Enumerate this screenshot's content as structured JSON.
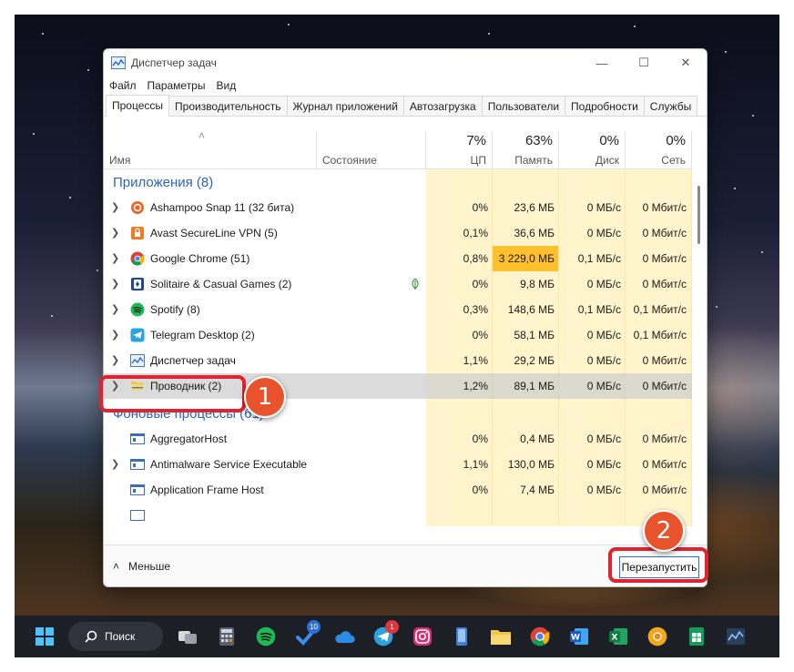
{
  "window": {
    "title": "Диспетчер задач",
    "menu": [
      "Файл",
      "Параметры",
      "Вид"
    ],
    "tabs": [
      "Процессы",
      "Производительность",
      "Журнал приложений",
      "Автозагрузка",
      "Пользователи",
      "Подробности",
      "Службы"
    ],
    "active_tab": "Процессы"
  },
  "columns": {
    "name": "Имя",
    "status": "Состояние",
    "cpu": {
      "pct": "7%",
      "label": "ЦП"
    },
    "memory": {
      "pct": "63%",
      "label": "Память"
    },
    "disk": {
      "pct": "0%",
      "label": "Диск"
    },
    "network": {
      "pct": "0%",
      "label": "Сеть"
    }
  },
  "groups": {
    "apps": "Приложения (8)",
    "background": "Фоновые процессы (61)"
  },
  "apps": [
    {
      "name": "Ashampoo Snap 11 (32 бита)",
      "cpu": "0%",
      "mem": "23,6 МБ",
      "disk": "0 МБ/с",
      "net": "0 Мбит/с",
      "icon": "ashampoo-icon"
    },
    {
      "name": "Avast SecureLine VPN (5)",
      "cpu": "0,1%",
      "mem": "36,6 МБ",
      "disk": "0 МБ/с",
      "net": "0 Мбит/с",
      "icon": "avast-vpn-icon"
    },
    {
      "name": "Google Chrome (51)",
      "cpu": "0,8%",
      "mem": "3 229,0 МБ",
      "disk": "0,1 МБ/с",
      "net": "0 Мбит/с",
      "icon": "chrome-icon"
    },
    {
      "name": "Solitaire & Casual Games (2)",
      "cpu": "0%",
      "mem": "9,8 МБ",
      "disk": "0 МБ/с",
      "net": "0 Мбит/с",
      "icon": "solitaire-icon"
    },
    {
      "name": "Spotify (8)",
      "cpu": "0,3%",
      "mem": "148,6 МБ",
      "disk": "0,1 МБ/с",
      "net": "0,1 Мбит/с",
      "icon": "spotify-icon"
    },
    {
      "name": "Telegram Desktop (2)",
      "cpu": "0%",
      "mem": "58,1 МБ",
      "disk": "0 МБ/с",
      "net": "0,1 Мбит/с",
      "icon": "telegram-icon"
    },
    {
      "name": "Диспетчер задач",
      "cpu": "1,1%",
      "mem": "29,2 МБ",
      "disk": "0 МБ/с",
      "net": "0 Мбит/с",
      "icon": "task-manager-icon"
    },
    {
      "name": "Проводник (2)",
      "cpu": "1,2%",
      "mem": "89,1 МБ",
      "disk": "0 МБ/с",
      "net": "0 Мбит/с",
      "icon": "explorer-icon"
    }
  ],
  "background": [
    {
      "name": "AggregatorHost",
      "cpu": "0%",
      "mem": "0,4 МБ",
      "disk": "0 МБ/с",
      "net": "0 Мбит/с",
      "icon": "service-icon"
    },
    {
      "name": "Antimalware Service Executable",
      "cpu": "1,1%",
      "mem": "130,0 МБ",
      "disk": "0 МБ/с",
      "net": "0 Мбит/с",
      "icon": "service-icon"
    },
    {
      "name": "Application Frame Host",
      "cpu": "0%",
      "mem": "7,4 МБ",
      "disk": "0 МБ/с",
      "net": "0 Мбит/с",
      "icon": "service-icon"
    }
  ],
  "footer": {
    "less_label": "Меньше",
    "restart_label": "Перезапустить"
  },
  "annotations": {
    "marker1": "1",
    "marker2": "2"
  },
  "taskbar": {
    "search_label": "Поиск",
    "badges": {
      "todo": "10",
      "telegram": "1"
    }
  },
  "colors": {
    "accent": "#2a66b8",
    "heat_light": "#fff4cc",
    "heat_hot": "#ffc02e",
    "highlight": "#e0232e",
    "marker": "#e8532c"
  }
}
